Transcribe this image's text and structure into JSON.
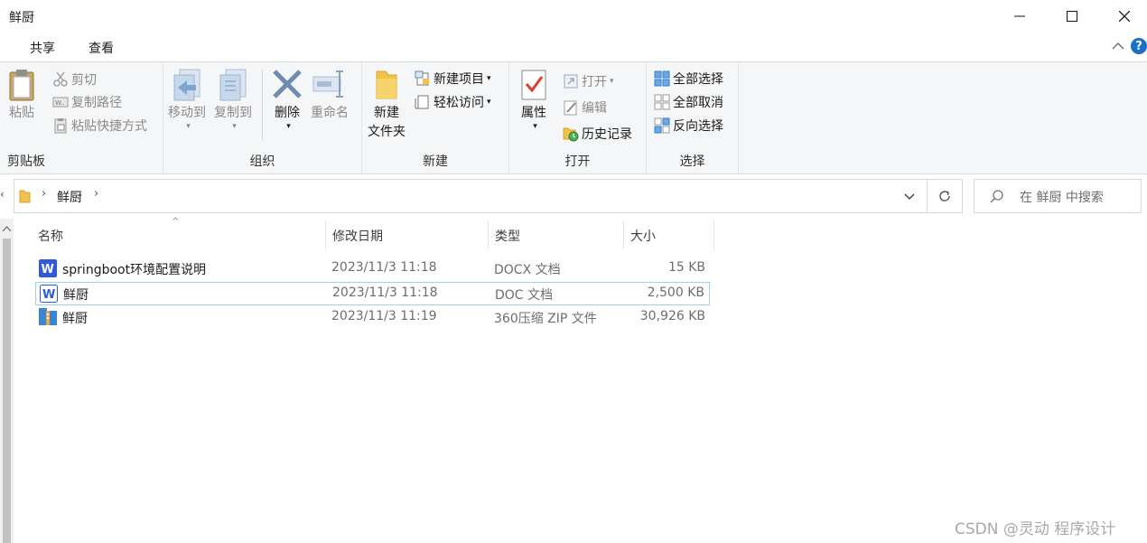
{
  "window": {
    "title": "鲜厨"
  },
  "ribbon_tabs": {
    "share": "共享",
    "view": "查看"
  },
  "ribbon": {
    "clipboard": {
      "group_label": "剪贴板",
      "paste": "粘贴",
      "cut": "剪切",
      "copy_path": "复制路径",
      "paste_shortcut": "粘贴快捷方式"
    },
    "organize": {
      "group_label": "组织",
      "move_to": "移动到",
      "copy_to": "复制到",
      "delete": "删除",
      "rename": "重命名"
    },
    "new": {
      "group_label": "新建",
      "new_folder_line1": "新建",
      "new_folder_line2": "文件夹",
      "new_item": "新建项目",
      "easy_access": "轻松访问"
    },
    "open": {
      "group_label": "打开",
      "properties": "属性",
      "open": "打开",
      "edit": "编辑",
      "history": "历史记录"
    },
    "select": {
      "group_label": "选择",
      "select_all": "全部选择",
      "select_none": "全部取消",
      "invert_selection": "反向选择"
    }
  },
  "address_bar": {
    "breadcrumb": "鲜厨"
  },
  "search": {
    "placeholder": "在 鲜厨 中搜索"
  },
  "columns": {
    "name": "名称",
    "modified": "修改日期",
    "type": "类型",
    "size": "大小"
  },
  "files": [
    {
      "name": "springboot环境配置说明",
      "modified": "2023/11/3 11:18",
      "type": "DOCX 文档",
      "size": "15 KB",
      "icon": "docx-file-icon"
    },
    {
      "name": "鲜厨",
      "modified": "2023/11/3 11:18",
      "type": "DOC 文档",
      "size": "2,500 KB",
      "icon": "doc-file-icon"
    },
    {
      "name": "鲜厨",
      "modified": "2023/11/3 11:19",
      "type": "360压缩 ZIP 文件",
      "size": "30,926 KB",
      "icon": "zip-archive-icon"
    }
  ],
  "watermark": "CSDN @灵动 程序设计",
  "colors": {
    "ribbon_bg": "#f5f6f7",
    "selection_border": "#99d1ff",
    "help_blue": "#1a6fc7",
    "wps_blue": "#2f5cd6"
  }
}
